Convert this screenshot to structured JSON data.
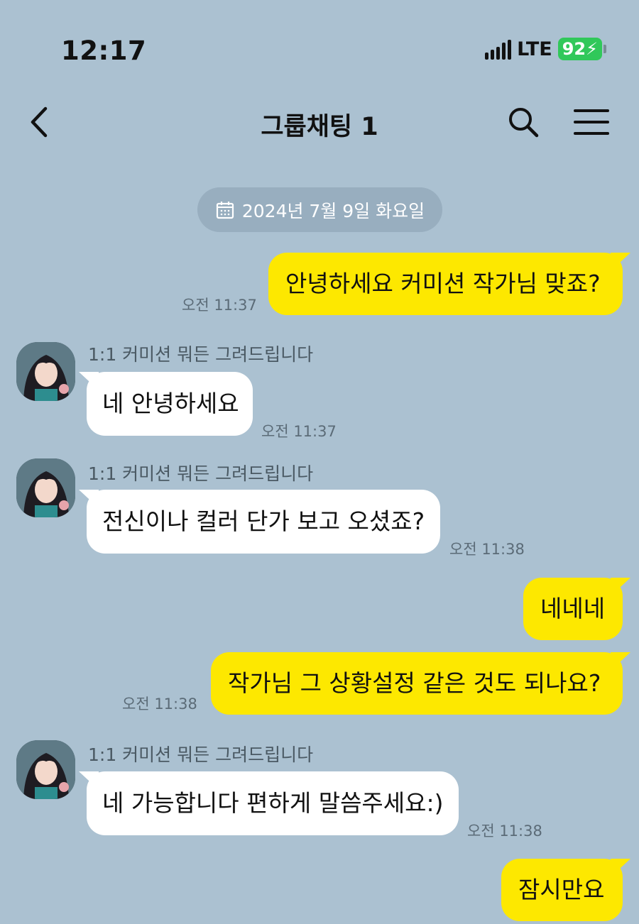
{
  "status_bar": {
    "time": "12:17",
    "network": "LTE",
    "battery": "92"
  },
  "header": {
    "title": "그룹채팅 1"
  },
  "date_divider": "2024년 7월 9일 화요일",
  "messages": [
    {
      "text": "안녕하세요 커미션 작가님 맞죠?",
      "time": "오전 11:37"
    },
    {
      "sender": "1:1 커미션 뭐든 그려드립니다",
      "text": "네 안녕하세요",
      "time": "오전 11:37"
    },
    {
      "sender": "1:1 커미션 뭐든 그려드립니다",
      "text": "전신이나 컬러 단가 보고 오셨죠?",
      "time": "오전 11:38"
    },
    {
      "text": "네네네"
    },
    {
      "text": "작가님 그 상황설정 같은 것도 되나요?",
      "time": "오전 11:38"
    },
    {
      "sender": "1:1 커미션 뭐든 그려드립니다",
      "text": "네 가능합니다 편하게 말씀주세요:)",
      "time": "오전 11:38"
    },
    {
      "text": "잠시만요"
    }
  ],
  "colors": {
    "background": "#abc1d1",
    "outgoing_bubble": "#fde800",
    "incoming_bubble": "#ffffff",
    "battery": "#30c85a"
  },
  "icons": {
    "back": "chevron-left-icon",
    "search": "search-icon",
    "menu": "hamburger-menu-icon",
    "calendar": "calendar-icon"
  }
}
